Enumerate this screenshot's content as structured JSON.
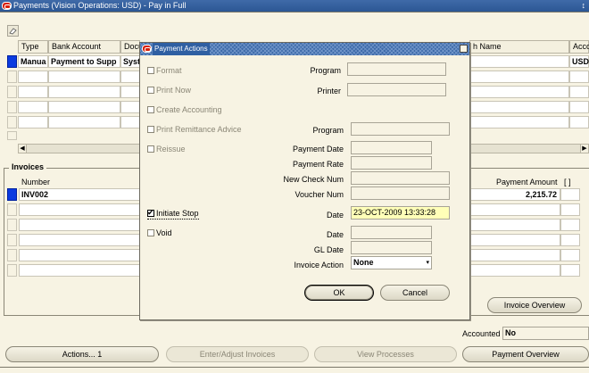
{
  "window": {
    "title": "Payments (Vision Operations: USD) - Pay in Full"
  },
  "payments": {
    "columns": [
      "Type",
      "Bank Account",
      "Docu",
      "h Name",
      "Acco"
    ],
    "row": {
      "type": "Manua",
      "bank_account": "Payment to Supp",
      "document": "Syst",
      "currency": "USD"
    }
  },
  "invoices": {
    "section_title": "Invoices",
    "number_header": "Number",
    "amount_header": "Payment Amount",
    "bracket_header": "[ ]",
    "row": {
      "number": "INV002",
      "amount": "2,215.72"
    },
    "invoice_overview_button": "Invoice Overview"
  },
  "accounted": {
    "label": "Accounted",
    "value": "No"
  },
  "bottom_buttons": {
    "actions": "Actions... 1",
    "enter_adjust": "Enter/Adjust Invoices",
    "view_processes": "View Processes",
    "payment_overview": "Payment Overview"
  },
  "dialog": {
    "title": "Payment Actions",
    "format": "Format",
    "print_now": "Print Now",
    "create_accounting": "Create Accounting",
    "print_remittance": "Print Remittance Advice",
    "reissue": "Reissue",
    "initiate_stop": "Initiate Stop",
    "void": "Void",
    "program_label": "Program",
    "printer_label": "Printer",
    "program2_label": "Program",
    "payment_date_label": "Payment Date",
    "payment_rate_label": "Payment Rate",
    "new_check_label": "New Check Num",
    "voucher_label": "Voucher Num",
    "stop_date_label": "Date",
    "stop_date_value": "23-OCT-2009 13:33:28",
    "void_date_label": "Date",
    "gl_date_label": "GL Date",
    "invoice_action_label": "Invoice Action",
    "invoice_action_value": "None",
    "ok": "OK",
    "cancel": "Cancel"
  }
}
